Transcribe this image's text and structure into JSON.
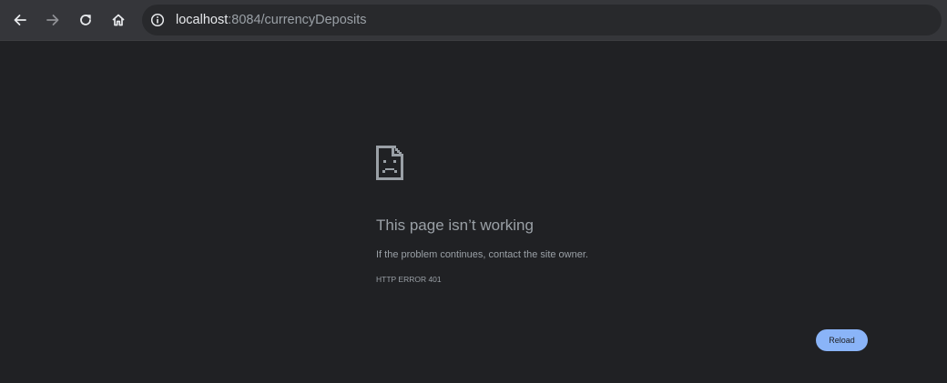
{
  "browser": {
    "url_host": "localhost",
    "url_rest": ":8084/currencyDeposits",
    "icons": {
      "back": "arrow-left-icon",
      "forward": "arrow-right-icon",
      "reload": "reload-icon",
      "home": "home-icon",
      "site_info": "info-circle-icon"
    }
  },
  "error_page": {
    "icon": "sad-page-icon",
    "title": "This page isn’t working",
    "description": "If the problem continues, contact the site owner.",
    "error_code": "HTTP ERROR 401",
    "reload_label": "Reload"
  },
  "colors": {
    "toolbar": "#35363a",
    "page_background": "#202124",
    "text_muted": "#9aa0a6",
    "accent": "#8ab4f8"
  }
}
